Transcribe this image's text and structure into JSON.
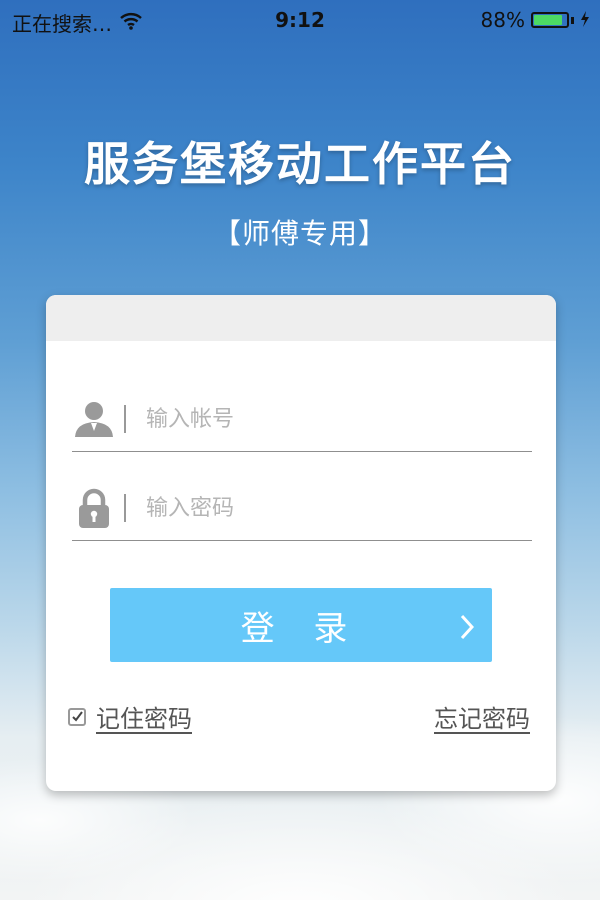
{
  "status_bar": {
    "carrier": "正在搜索…",
    "time": "9:12",
    "battery_percent": "88%",
    "battery_level": 0.88,
    "icons": [
      "wifi-icon",
      "battery-icon",
      "charging-icon"
    ]
  },
  "app": {
    "title": "服务堡移动工作平台",
    "subtitle": "【师傅专用】"
  },
  "login_form": {
    "account_placeholder": "输入帐号",
    "password_placeholder": "输入密码",
    "login_label": "登 录",
    "remember_label": "记住密码",
    "remember_checked": true,
    "forgot_label": "忘记密码"
  },
  "colors": {
    "button": "#65c8f9",
    "battery": "#4cd964"
  }
}
